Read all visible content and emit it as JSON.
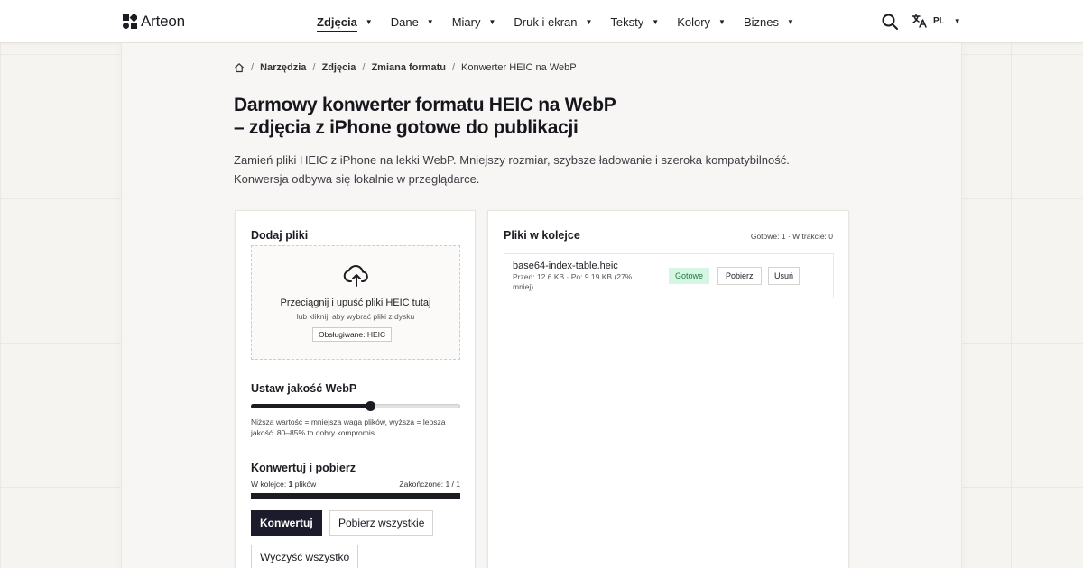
{
  "brand": {
    "name": "Arteon"
  },
  "nav": {
    "items": [
      {
        "label": "Zdjęcia",
        "active": true
      },
      {
        "label": "Dane",
        "active": false
      },
      {
        "label": "Miary",
        "active": false
      },
      {
        "label": "Druk i ekran",
        "active": false
      },
      {
        "label": "Teksty",
        "active": false
      },
      {
        "label": "Kolory",
        "active": false
      },
      {
        "label": "Biznes",
        "active": false
      }
    ],
    "search_icon": "search-icon",
    "language": {
      "icon": "translate-icon",
      "code": "PL"
    }
  },
  "breadcrumb": {
    "home_icon": "home-icon",
    "items": [
      "Narzędzia",
      "Zdjęcia",
      "Zmiana formatu"
    ],
    "current": "Konwerter HEIC na WebP"
  },
  "page": {
    "title_line1": "Darmowy konwerter formatu HEIC na WebP",
    "title_line2": "– zdjęcia z iPhone gotowe do publikacji",
    "lead": "Zamień pliki HEIC z iPhone na lekki WebP. Mniejszy rozmiar, szybsze ładowanie i szeroka kompatybilność. Konwersja odbywa się lokalnie w przeglądarce."
  },
  "upload": {
    "heading": "Dodaj pliki",
    "icon": "cloud-upload-icon",
    "drop_title": "Przeciągnij i upuść pliki HEIC tutaj",
    "drop_subtitle": "lub kliknij, aby wybrać pliki z dysku",
    "supported": "Obsługiwane: HEIC"
  },
  "quality": {
    "heading": "Ustaw jakość WebP",
    "value_fraction": 0.57,
    "hint": "Niższa wartość = mniejsza waga plików, wyższa = lepsza jakość. 80–85% to dobry kompromis."
  },
  "convert": {
    "heading": "Konwertuj i pobierz",
    "queue_prefix": "W kolejce:",
    "queue_count": "1",
    "queue_suffix": "plików",
    "finished": "Zakończone: 1 / 1",
    "progress_fraction": 1.0,
    "convert_button": "Konwertuj",
    "download_all_button": "Pobierz wszystkie",
    "clear_button": "Wyczyść wszystko"
  },
  "queue": {
    "heading": "Pliki w kolejce",
    "status": "Gotowe: 1 · W trakcie: 0",
    "files": [
      {
        "name": "base64-index-table.heic",
        "meta": "Przed: 12.6 KB · Po: 9.19 KB (27% mniej)",
        "status": "Gotowe",
        "download_label": "Pobierz",
        "remove_label": "Usuń"
      }
    ]
  },
  "colors": {
    "accent": "#1b1b2b",
    "success_bg": "#d6f5e3",
    "success_text": "#1e7a49",
    "background": "#f6f4f1"
  }
}
